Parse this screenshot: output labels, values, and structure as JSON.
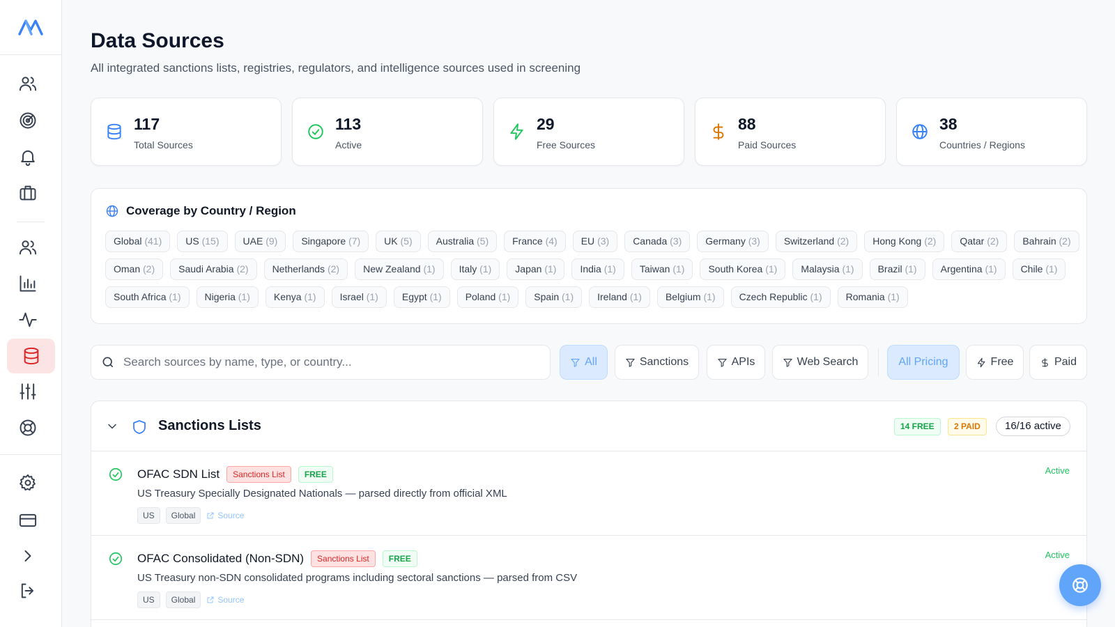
{
  "sidebar": {
    "logo_text": "M",
    "nav": [
      {
        "icon": "users-icon"
      },
      {
        "icon": "target-icon"
      },
      {
        "icon": "bell-icon"
      },
      {
        "icon": "briefcase-icon"
      },
      {
        "icon": "team-icon"
      },
      {
        "icon": "chart-icon"
      },
      {
        "icon": "activity-icon"
      },
      {
        "icon": "database-icon",
        "active": true
      },
      {
        "icon": "sliders-icon"
      },
      {
        "icon": "lifebuoy-icon"
      },
      {
        "icon": "gear-icon"
      },
      {
        "icon": "credit-card-icon"
      },
      {
        "icon": "chevron-right-icon"
      },
      {
        "icon": "logout-icon"
      }
    ]
  },
  "page": {
    "title": "Data Sources",
    "subtitle": "All integrated sanctions lists, registries, regulators, and intelligence sources used in screening"
  },
  "stats": [
    {
      "value": "117",
      "label": "Total Sources",
      "icon": "database-icon",
      "color": "#3b82f6"
    },
    {
      "value": "113",
      "label": "Active",
      "icon": "check-circle-icon",
      "color": "#22c55e"
    },
    {
      "value": "29",
      "label": "Free Sources",
      "icon": "zap-icon",
      "color": "#22c55e"
    },
    {
      "value": "88",
      "label": "Paid Sources",
      "icon": "dollar-icon",
      "color": "#d97706"
    },
    {
      "value": "38",
      "label": "Countries / Regions",
      "icon": "globe-icon",
      "color": "#3b82f6"
    }
  ],
  "coverage": {
    "title": "Coverage by Country / Region",
    "chips": [
      {
        "name": "Global",
        "count": "(41)"
      },
      {
        "name": "US",
        "count": "(15)"
      },
      {
        "name": "UAE",
        "count": "(9)"
      },
      {
        "name": "Singapore",
        "count": "(7)"
      },
      {
        "name": "UK",
        "count": "(5)"
      },
      {
        "name": "Australia",
        "count": "(5)"
      },
      {
        "name": "France",
        "count": "(4)"
      },
      {
        "name": "EU",
        "count": "(3)"
      },
      {
        "name": "Canada",
        "count": "(3)"
      },
      {
        "name": "Germany",
        "count": "(3)"
      },
      {
        "name": "Switzerland",
        "count": "(2)"
      },
      {
        "name": "Hong Kong",
        "count": "(2)"
      },
      {
        "name": "Qatar",
        "count": "(2)"
      },
      {
        "name": "Bahrain",
        "count": "(2)"
      },
      {
        "name": "Oman",
        "count": "(2)"
      },
      {
        "name": "Saudi Arabia",
        "count": "(2)"
      },
      {
        "name": "Netherlands",
        "count": "(2)"
      },
      {
        "name": "New Zealand",
        "count": "(1)"
      },
      {
        "name": "Italy",
        "count": "(1)"
      },
      {
        "name": "Japan",
        "count": "(1)"
      },
      {
        "name": "India",
        "count": "(1)"
      },
      {
        "name": "Taiwan",
        "count": "(1)"
      },
      {
        "name": "South Korea",
        "count": "(1)"
      },
      {
        "name": "Malaysia",
        "count": "(1)"
      },
      {
        "name": "Brazil",
        "count": "(1)"
      },
      {
        "name": "Argentina",
        "count": "(1)"
      },
      {
        "name": "Chile",
        "count": "(1)"
      },
      {
        "name": "South Africa",
        "count": "(1)"
      },
      {
        "name": "Nigeria",
        "count": "(1)"
      },
      {
        "name": "Kenya",
        "count": "(1)"
      },
      {
        "name": "Israel",
        "count": "(1)"
      },
      {
        "name": "Egypt",
        "count": "(1)"
      },
      {
        "name": "Poland",
        "count": "(1)"
      },
      {
        "name": "Spain",
        "count": "(1)"
      },
      {
        "name": "Ireland",
        "count": "(1)"
      },
      {
        "name": "Belgium",
        "count": "(1)"
      },
      {
        "name": "Czech Republic",
        "count": "(1)"
      },
      {
        "name": "Romania",
        "count": "(1)"
      }
    ]
  },
  "search": {
    "placeholder": "Search sources by name, type, or country..."
  },
  "filters": {
    "type": [
      {
        "label": "All",
        "selected": true
      },
      {
        "label": "Sanctions"
      },
      {
        "label": "APIs"
      },
      {
        "label": "Web Search"
      }
    ],
    "pricing": [
      {
        "label": "All Pricing",
        "selected": true
      },
      {
        "label": "Free"
      },
      {
        "label": "Paid"
      }
    ]
  },
  "section": {
    "title": "Sanctions Lists",
    "free_badge": "14 FREE",
    "paid_badge": "2 PAID",
    "active_badge": "16/16 active",
    "rows": [
      {
        "name": "OFAC SDN List",
        "type_tag": "Sanctions List",
        "pricing_tag": "FREE",
        "description": "US Treasury Specially Designated Nationals — parsed directly from official XML",
        "tags": [
          "US",
          "Global"
        ],
        "source_label": "Source",
        "status": "Active"
      },
      {
        "name": "OFAC Consolidated (Non-SDN)",
        "type_tag": "Sanctions List",
        "pricing_tag": "FREE",
        "description": "US Treasury non-SDN consolidated programs including sectoral sanctions — parsed from CSV",
        "tags": [
          "US",
          "Global"
        ],
        "source_label": "Source",
        "status": "Active"
      }
    ]
  },
  "colors": {
    "accent": "#3b82f6",
    "active_nav_bg": "#fde4e4",
    "active_nav_icon": "#dc2626",
    "success": "#22c55e",
    "warning": "#d97706"
  }
}
